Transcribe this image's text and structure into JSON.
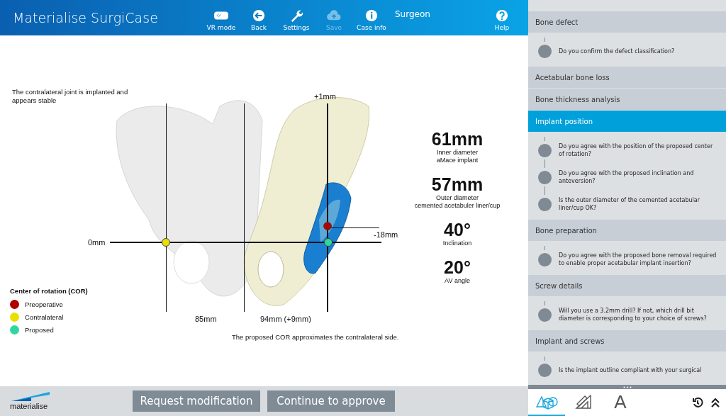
{
  "header": {
    "title": "Materialise SurgiCase",
    "tools": [
      {
        "kind": "vr",
        "label": "VR mode",
        "disabled": false
      },
      {
        "kind": "back",
        "label": "Back",
        "disabled": false
      },
      {
        "kind": "settings",
        "label": "Settings",
        "disabled": false
      },
      {
        "kind": "save",
        "label": "Save",
        "disabled": true
      },
      {
        "kind": "info",
        "label": "Case info",
        "disabled": false
      }
    ],
    "role": "Surgeon",
    "help": {
      "kind": "help",
      "label": "Help",
      "disabled": false
    }
  },
  "viewer": {
    "note": "The contralateral joint is implanted  and appears stable",
    "labels": [
      {
        "kind": "top",
        "text": "+1mm"
      },
      {
        "kind": "left",
        "text": "0mm"
      },
      {
        "kind": "right",
        "text": "-18mm"
      },
      {
        "kind": "dist1",
        "text": "85mm"
      },
      {
        "kind": "dist2",
        "text": "94mm (+9mm)"
      }
    ],
    "caption": "The proposed COR approximates the contralateral side.",
    "metrics": [
      {
        "value": "61mm",
        "lines": [
          "Inner diameter",
          "aMace implant"
        ]
      },
      {
        "value": "57mm",
        "lines": [
          "Outer diameter",
          "cemented acetabuler liner/cup"
        ]
      },
      {
        "value": "40°",
        "lines": [
          "Inclination"
        ]
      },
      {
        "value": "20°",
        "lines": [
          "AV angle"
        ]
      }
    ],
    "legend": {
      "title": "Center of rotation (COR)",
      "items": [
        {
          "label": "Preoperative",
          "color": "#b00000"
        },
        {
          "label": "Contralateral",
          "color": "#e8e000"
        },
        {
          "label": "Proposed",
          "color": "#2fd6a0"
        }
      ]
    }
  },
  "footer": {
    "logo": "materialise",
    "buttons": [
      "Request modification",
      "Continue to approve"
    ]
  },
  "panel": {
    "sections": [
      {
        "title": "Bone defect",
        "selected": false,
        "questions": [
          "Do you confirm the defect classification?"
        ]
      },
      {
        "title": "Acetabular bone loss",
        "selected": false
      },
      {
        "title": "Bone thickness analysis",
        "selected": false
      },
      {
        "title": "Implant position",
        "selected": true,
        "questions": [
          "Do you agree with the position of the proposed center of rotation?",
          "Do you agree with the proposed inclination and anteversion?",
          "Is the outer diameter of the cemented acetabular liner/cup OK?"
        ]
      },
      {
        "title": "Bone preparation",
        "selected": false,
        "questions": [
          "Do you agree with the proposed bone removal required to enable proper acetabular implant insertion?"
        ]
      },
      {
        "title": "Screw details",
        "selected": false,
        "questions": [
          "Will you use a 3.2mm drill? If not, which drill bit diameter is corresponding to your choice of screws?"
        ]
      },
      {
        "title": "Implant and screws",
        "selected": false,
        "questions": [
          "Is the implant outline compliant with your surgical"
        ]
      }
    ],
    "tools": [
      {
        "kind": "shapes",
        "selected": true
      },
      {
        "kind": "ruler",
        "selected": false
      },
      {
        "kind": "text",
        "label": "A",
        "selected": false
      }
    ]
  }
}
